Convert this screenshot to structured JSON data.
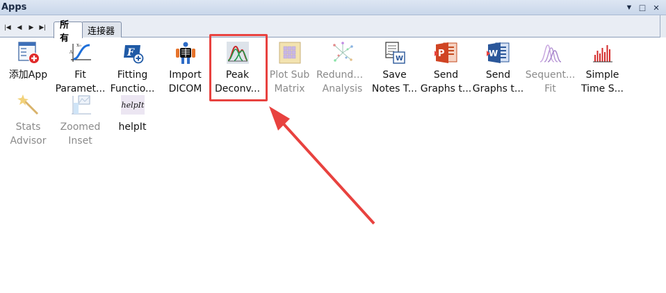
{
  "window": {
    "title": "Apps"
  },
  "tabs": [
    {
      "label": "所有",
      "active": true
    },
    {
      "label": "连接器",
      "active": false
    }
  ],
  "apps": [
    {
      "line1": "添加App",
      "line2": "",
      "icon": "add-app-icon",
      "disabled": false
    },
    {
      "line1": "Fit",
      "line2": "Paramet...",
      "icon": "fit-parameters-icon",
      "disabled": false
    },
    {
      "line1": "Fitting",
      "line2": "Functio...",
      "icon": "fitting-function-icon",
      "disabled": false
    },
    {
      "line1": "Import",
      "line2": "DICOM",
      "icon": "xray-skeleton-icon",
      "disabled": false
    },
    {
      "line1": "Peak",
      "line2": "Deconv...",
      "icon": "peak-deconvolution-icon",
      "disabled": false
    },
    {
      "line1": "Plot Sub",
      "line2": "Matrix",
      "icon": "matrix-grid-icon",
      "disabled": true
    },
    {
      "line1": "Redunda...",
      "line2": "Analysis",
      "icon": "network-scatter-icon",
      "disabled": true
    },
    {
      "line1": "Save",
      "line2": "Notes T...",
      "icon": "save-notes-word-icon",
      "disabled": false
    },
    {
      "line1": "Send",
      "line2": "Graphs t...",
      "icon": "powerpoint-icon",
      "disabled": false
    },
    {
      "line1": "Send",
      "line2": "Graphs t...",
      "icon": "word-icon",
      "disabled": false
    },
    {
      "line1": "Sequent...",
      "line2": "Fit",
      "icon": "sequential-fit-peaks-icon",
      "disabled": true
    },
    {
      "line1": "Simple",
      "line2": "Time S...",
      "icon": "time-series-bars-icon",
      "disabled": false
    },
    {
      "line1": "Stats",
      "line2": "Advisor",
      "icon": "magic-wand-icon",
      "disabled": true
    },
    {
      "line1": "Zoomed",
      "line2": "Inset",
      "icon": "zoomed-inset-icon",
      "disabled": true
    },
    {
      "line1": "helpIt",
      "line2": "",
      "icon": "helpit-icon",
      "disabled": false,
      "icon_text": "helpIt"
    }
  ],
  "colors": {
    "highlight": "#e8423f",
    "title_bar": "#c9d7ea"
  }
}
